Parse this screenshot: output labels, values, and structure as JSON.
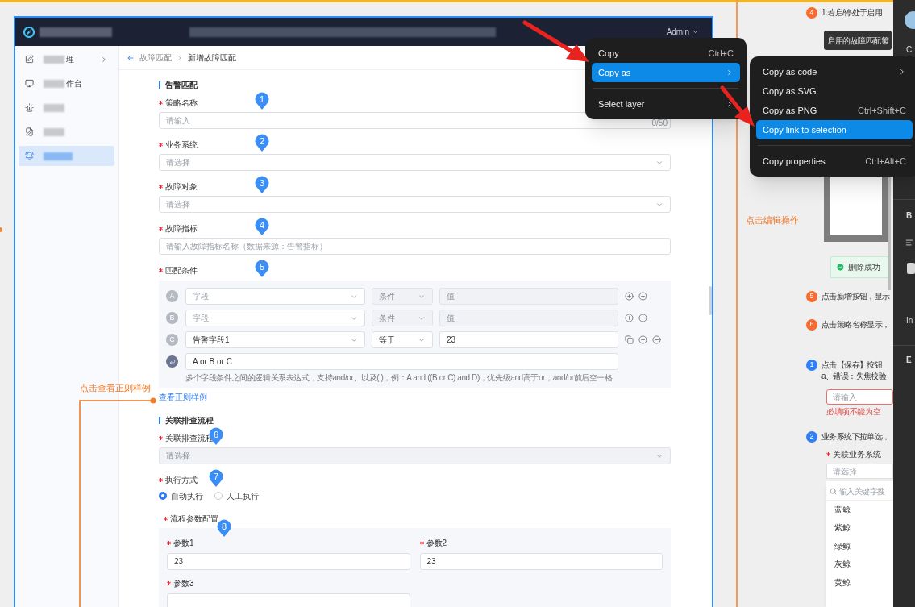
{
  "app": {
    "header": {
      "user": "Admin"
    },
    "sidebar": [
      {
        "text": "理",
        "chevron": true,
        "selected": false
      },
      {
        "text": "作台",
        "chevron": false,
        "selected": false
      },
      {
        "chevron": false,
        "selected": false
      },
      {
        "chevron": false,
        "selected": false
      },
      {
        "chevron": false,
        "selected": true
      }
    ],
    "breadcrumb": {
      "parent": "故障匹配",
      "current": "新增故障匹配"
    },
    "sections": [
      {
        "title": "告警匹配",
        "fields": [
          {
            "kind": "input",
            "label": "策略名称",
            "required": true,
            "pin": "1",
            "placeholder": "请输入",
            "counter": "0/50"
          },
          {
            "kind": "select",
            "label": "业务系统",
            "required": true,
            "pin": "2",
            "placeholder": "请选择",
            "disabled": false
          },
          {
            "kind": "select",
            "label": "故障对象",
            "required": true,
            "pin": "3",
            "placeholder": "请选择",
            "disabled": false
          },
          {
            "kind": "input",
            "label": "故障指标",
            "required": true,
            "pin": "4",
            "placeholder": "请输入故障指标名称（数据来源：告警指标）"
          },
          {
            "kind": "conditions",
            "label": "匹配条件",
            "required": true,
            "pin": "5",
            "rows": [
              {
                "letter": "A",
                "field": {
                  "placeholder": "字段"
                },
                "op": {
                  "placeholder": "条件",
                  "disabled": true
                },
                "value": {
                  "placeholder": "值",
                  "disabled": true
                },
                "copyable": false
              },
              {
                "letter": "B",
                "field": {
                  "placeholder": "字段"
                },
                "op": {
                  "placeholder": "条件",
                  "disabled": true
                },
                "value": {
                  "placeholder": "值",
                  "disabled": true
                },
                "copyable": false
              },
              {
                "letter": "C",
                "field": {
                  "value": "告警字段1"
                },
                "op": {
                  "value": "等于",
                  "disabled": false
                },
                "value": {
                  "value": "23",
                  "disabled": false
                },
                "copyable": true
              }
            ],
            "expression": "A or B or C",
            "hint": "多个字段条件之间的逻辑关系表达式，支持and/or、以及( )，例：A and ((B or C) and D)，优先级and高于or，and/or前后空一格"
          },
          {
            "kind": "link",
            "text": "查看正则样例"
          }
        ]
      },
      {
        "title": "关联排查流程",
        "fields": [
          {
            "kind": "select",
            "label": "关联排查流程",
            "required": true,
            "pin": "6",
            "placeholder": "请选择",
            "disabled": true
          },
          {
            "kind": "radio",
            "label": "执行方式",
            "required": true,
            "pin": "7",
            "options": [
              {
                "label": "自动执行",
                "selected": true
              },
              {
                "label": "人工执行",
                "selected": false
              }
            ]
          },
          {
            "kind": "params",
            "label": "流程参数配置",
            "required": true,
            "pin": "8",
            "params": [
              {
                "label": "参数1",
                "required": true,
                "value": "23"
              },
              {
                "label": "参数2",
                "required": true,
                "value": "23"
              },
              {
                "label": "参数3",
                "required": true
              }
            ]
          }
        ]
      }
    ]
  },
  "context_menu": [
    {
      "label": "Copy",
      "shortcut": "Ctrl+C",
      "submenu": false,
      "divider_before": false,
      "selected": false
    },
    {
      "label": "Copy as",
      "submenu": true,
      "divider_before": false,
      "selected": true
    },
    {
      "label": "Select layer",
      "submenu": true,
      "divider_before": true,
      "selected": false
    }
  ],
  "submenu": [
    {
      "label": "Copy as code",
      "submenu": true,
      "divider_before": false,
      "selected": false
    },
    {
      "label": "Copy as SVG",
      "submenu": false,
      "divider_before": false,
      "selected": false
    },
    {
      "label": "Copy as PNG",
      "shortcut": "Ctrl+Shift+C",
      "submenu": false,
      "divider_before": false,
      "selected": false
    },
    {
      "label": "Copy link to selection",
      "submenu": false,
      "divider_before": false,
      "selected": true
    },
    {
      "label": "Copy properties",
      "shortcut": "Ctrl+Alt+C",
      "submenu": false,
      "divider_before": true,
      "selected": false
    }
  ],
  "annotations": {
    "regex_note": "点击查看正则样例",
    "edit_note": "点击编辑操作",
    "tooltip": "启用的故障匹配策",
    "toast": "删除成功",
    "steps": [
      {
        "number": "4",
        "color": "#fa6a2c",
        "lines": [
          "1.若启/停处于启用"
        ]
      },
      {
        "number": "5",
        "color": "#fa6a2c",
        "lines": [
          "点击新增按钮，显示"
        ]
      },
      {
        "number": "6",
        "color": "#fa6a2c",
        "lines": [
          "点击策略名称显示，"
        ]
      },
      {
        "number": "1",
        "color": "#2f80f6",
        "lines": [
          "点击【保存】按钮",
          "a、错误：失焦校验"
        ]
      },
      {
        "number": "2",
        "color": "#2f80f6",
        "lines": [
          "业务系统下拉单选，"
        ]
      }
    ],
    "error_field": {
      "placeholder": "请输入",
      "error": "必填项不能为空"
    },
    "system_select": {
      "label": "关联业务系统",
      "required": true,
      "placeholder": "请选择",
      "search_placeholder": "输入关键字搜",
      "options": [
        "蓝鲸",
        "紫鲸",
        "绿鲸",
        "灰鲸",
        "黄鲸"
      ]
    }
  },
  "inspector": {
    "texts": [
      "C",
      "B",
      "In",
      "E"
    ]
  }
}
